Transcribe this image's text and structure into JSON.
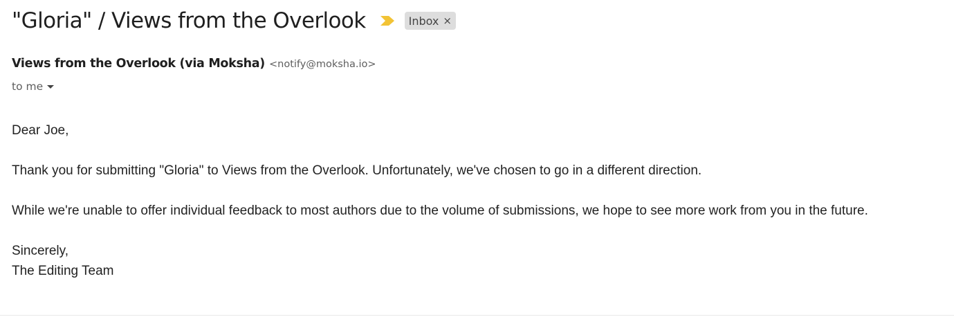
{
  "message": {
    "subject": "\"Gloria\" / Views from the Overlook",
    "importance_icon": "importance-marker-icon",
    "label": {
      "name": "Inbox",
      "remove_glyph": "×"
    },
    "sender": {
      "name": "Views from the Overlook (via Moksha)",
      "email": "<notify@moksha.io>"
    },
    "recipient": "to me",
    "body": {
      "greeting": "Dear Joe,",
      "paragraph1": "Thank you for submitting \"Gloria\" to Views from the Overlook. Unfortunately, we've chosen to go in a different direction.",
      "paragraph2": "While we're unable to offer individual feedback to most authors due to the volume of submissions, we hope to see more work from you in the future.",
      "closing": "Sincerely,",
      "signature": "The Editing Team"
    }
  },
  "colors": {
    "importance": "#f2c335",
    "label_bg": "#dddddd",
    "text": "#222222",
    "muted": "#5e5e5e"
  }
}
